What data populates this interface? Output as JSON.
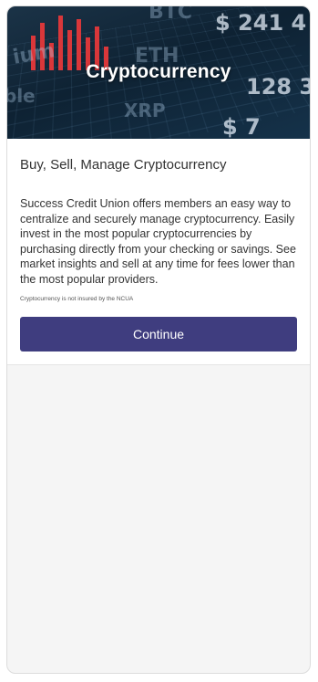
{
  "hero": {
    "title": "Cryptocurrency",
    "bg_tickers": {
      "btc": "BTC",
      "eth": "ETH",
      "xrp": "XRP",
      "price_top": "$ 241 4",
      "price_mid": "128 3",
      "price_bot": "$ 7",
      "frag_left": "ium",
      "frag_left2": "ble"
    }
  },
  "content": {
    "heading": "Buy, Sell, Manage Cryptocurrency",
    "description": "Success Credit Union offers members an easy way to centralize and securely manage cryptocurrency. Easily invest in the most popular cryptocurrencies by purchasing directly from your checking or savings. See market insights and sell at any time for fees lower than the most popular providers.",
    "disclaimer": "Cryptocurrency is not insured by the NCUA",
    "continue_label": "Continue"
  },
  "colors": {
    "button": "#3f3d7f",
    "hero_bg": "#0e2233",
    "candle": "#d9373a"
  }
}
